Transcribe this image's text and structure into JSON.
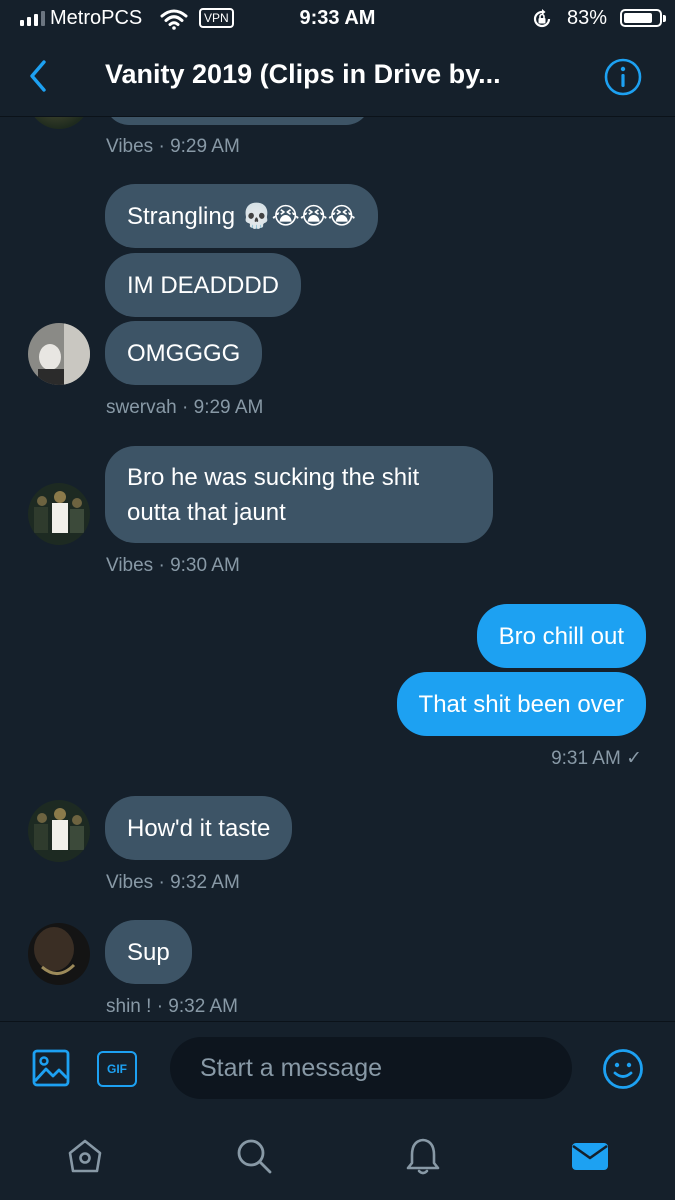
{
  "status_bar": {
    "carrier": "MetroPCS",
    "vpn": "VPN",
    "time": "9:33 AM",
    "battery": "83%",
    "battery_level": 0.83
  },
  "header": {
    "title": "Vanity 2019 (Clips in Drive by..."
  },
  "conversation": {
    "meta": [
      "Vibes · 9:29 AM",
      "swervah · 9:29 AM",
      "Vibes · 9:30 AM",
      "9:31 AM ✓",
      "Vibes · 9:32 AM",
      "shin ! · 9:32 AM"
    ],
    "messages": [
      {
        "sender": "swervah",
        "text": "Strangling 💀😭😭😭",
        "direction": "in"
      },
      {
        "sender": "swervah",
        "text": "IM DEADDDD",
        "direction": "in"
      },
      {
        "sender": "swervah",
        "text": "OMGGGG",
        "direction": "in"
      },
      {
        "sender": "Vibes",
        "text": "Bro he was sucking the shit outta that jaunt",
        "direction": "in"
      },
      {
        "sender": "me",
        "text": "Bro chill out",
        "direction": "out"
      },
      {
        "sender": "me",
        "text": "That shit been over",
        "direction": "out"
      },
      {
        "sender": "Vibes",
        "text": "How'd it taste",
        "direction": "in"
      },
      {
        "sender": "shin !",
        "text": "Sup",
        "direction": "in"
      }
    ]
  },
  "composer": {
    "gif_label": "GIF",
    "placeholder": "Start a message"
  },
  "icons": {
    "back": "chevron-left-icon",
    "info": "info-icon",
    "image": "image-icon",
    "emoji": "emoji-icon",
    "home": "home-icon",
    "search": "search-icon",
    "notifications": "bell-icon",
    "messages": "envelope-icon"
  },
  "colors": {
    "background": "#15202b",
    "accent": "#1da1f2",
    "incoming_bubble": "#3d5466",
    "secondary_text": "#8899a6"
  }
}
